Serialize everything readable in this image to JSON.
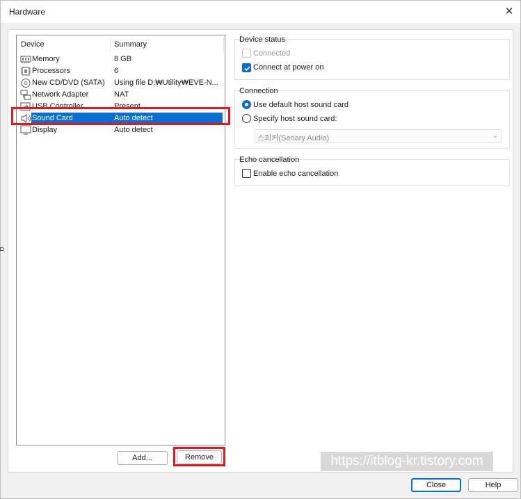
{
  "window": {
    "title": "Hardware",
    "close_glyph": "✕"
  },
  "device_list": {
    "columns": {
      "device": "Device",
      "summary": "Summary"
    },
    "rows": [
      {
        "icon": "memory-icon",
        "name": "Memory",
        "summary": "8 GB"
      },
      {
        "icon": "processor-icon",
        "name": "Processors",
        "summary": "6"
      },
      {
        "icon": "cd-dvd-icon",
        "name": "New CD/DVD (SATA)",
        "summary": "Using file D:₩Utility₩EVE-N..."
      },
      {
        "icon": "network-adapter-icon",
        "name": "Network Adapter",
        "summary": "NAT"
      },
      {
        "icon": "usb-controller-icon",
        "name": "USB Controller",
        "summary": "Present"
      },
      {
        "icon": "speaker-icon",
        "name": "Sound Card",
        "summary": "Auto detect",
        "selected": true
      },
      {
        "icon": "display-icon",
        "name": "Display",
        "summary": "Auto detect"
      }
    ],
    "add_button": "Add...",
    "remove_button": "Remove"
  },
  "device_status": {
    "title": "Device status",
    "connected": {
      "label": "Connected",
      "checked": false,
      "disabled": true
    },
    "connect_at_power_on": {
      "label": "Connect at power on",
      "checked": true
    }
  },
  "connection": {
    "title": "Connection",
    "use_default": {
      "label": "Use default host sound card",
      "selected": true
    },
    "specify": {
      "label": "Specify host sound card:",
      "selected": false
    },
    "host_card_value": "스피커(Senary Audio)"
  },
  "echo": {
    "title": "Echo cancellation",
    "enable": {
      "label": "Enable echo cancellation",
      "checked": false
    }
  },
  "footer": {
    "close_button": "Close",
    "help_button": "Help"
  },
  "watermark": "https://itblog-kr.tistory.com",
  "colors": {
    "accent": "#0a6fd0",
    "highlight_red": "#e8141f"
  }
}
